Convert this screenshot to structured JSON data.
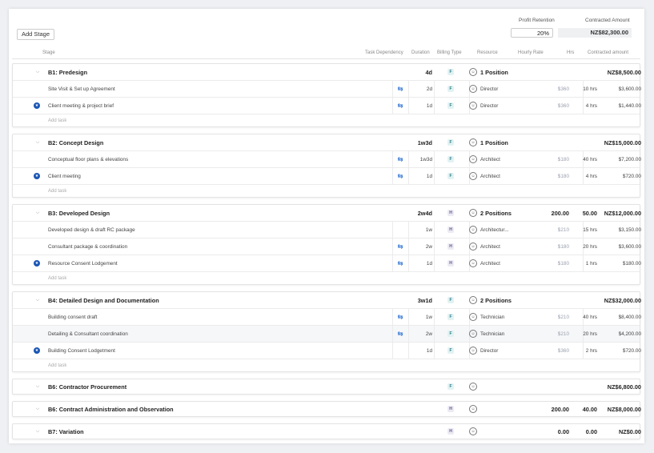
{
  "toolbar": {
    "add_stage_label": "Add Stage",
    "profit_retention_label": "Profit Retention",
    "profit_retention_value": "20%",
    "contracted_amount_label": "Contracted Amount",
    "contracted_amount_value": "NZ$82,300.00"
  },
  "columns": {
    "stage": "Stage",
    "task_dependency": "Task Dependency",
    "duration": "Duration",
    "billing_type": "Billing Type",
    "resource": "Resource",
    "hourly_rate": "Hourly Rate",
    "hrs": "Hrs",
    "contracted_amount": "Contracted amount"
  },
  "add_task_label": "Add task",
  "icons": {
    "collapse": "chevron-down-icon",
    "dependency": "link-arrows-icon",
    "milestone": "star-icon",
    "resource": "person-icon"
  },
  "colors": {
    "accent": "#1b56b4",
    "dependency": "#2a6fd1",
    "badge_f_bg": "#e2f2f3",
    "badge_h_bg": "#ecebf4"
  },
  "stages": [
    {
      "name": "B1: Predesign",
      "duration": "4d",
      "billing": "F",
      "resource": "1 Position",
      "rate": "",
      "hrs": "",
      "amount": "NZ$8,500.00",
      "tasks": [
        {
          "name": "Site Visit & Set up Agreement",
          "dep": true,
          "star": false,
          "duration": "2d",
          "billing": "F",
          "resource": "Director",
          "rate": "$360",
          "hrs": "10 hrs",
          "amount": "$3,600.00"
        },
        {
          "name": "Client meeting & project brief",
          "dep": true,
          "star": true,
          "duration": "1d",
          "billing": "F",
          "resource": "Director",
          "rate": "$360",
          "hrs": "4 hrs",
          "amount": "$1,440.00"
        }
      ]
    },
    {
      "name": "B2: Concept Design",
      "duration": "1w3d",
      "billing": "F",
      "resource": "1 Position",
      "rate": "",
      "hrs": "",
      "amount": "NZ$15,000.00",
      "tasks": [
        {
          "name": "Conceptual floor plans & elevations",
          "dep": true,
          "star": false,
          "duration": "1w3d",
          "billing": "F",
          "resource": "Architect",
          "rate": "$180",
          "hrs": "40 hrs",
          "amount": "$7,200.00"
        },
        {
          "name": "Client meeting",
          "dep": true,
          "star": true,
          "duration": "1d",
          "billing": "F",
          "resource": "Architect",
          "rate": "$180",
          "hrs": "4 hrs",
          "amount": "$720.00"
        }
      ]
    },
    {
      "name": "B3: Developed Design",
      "duration": "2w4d",
      "billing": "H",
      "resource": "2 Positions",
      "rate": "200.00",
      "hrs": "50.00",
      "amount": "NZ$12,000.00",
      "tasks": [
        {
          "name": "Developed design & draft RC package",
          "dep": false,
          "star": false,
          "duration": "1w",
          "billing": "H",
          "resource": "Architectur...",
          "rate": "$210",
          "hrs": "15 hrs",
          "amount": "$3,150.00"
        },
        {
          "name": "Consultant package & coordination",
          "dep": true,
          "star": false,
          "duration": "2w",
          "billing": "H",
          "resource": "Architect",
          "rate": "$180",
          "hrs": "20 hrs",
          "amount": "$3,600.00"
        },
        {
          "name": "Resource Consent Lodgement",
          "dep": true,
          "star": true,
          "duration": "1d",
          "billing": "H",
          "resource": "Architect",
          "rate": "$180",
          "hrs": "1 hrs",
          "amount": "$180.00"
        }
      ]
    },
    {
      "name": "B4: Detailed Design and Documentation",
      "duration": "3w1d",
      "billing": "F",
      "resource": "2 Positions",
      "rate": "",
      "hrs": "",
      "amount": "NZ$32,000.00",
      "tasks": [
        {
          "name": "Building consent draft",
          "dep": true,
          "star": false,
          "duration": "1w",
          "billing": "F",
          "resource": "Technician",
          "rate": "$210",
          "hrs": "40 hrs",
          "amount": "$8,400.00"
        },
        {
          "name": "Detailing & Consultant coordination",
          "dep": true,
          "star": false,
          "highlight": true,
          "duration": "2w",
          "billing": "F",
          "resource": "Technician",
          "rate": "$210",
          "hrs": "20 hrs",
          "amount": "$4,200.00"
        },
        {
          "name": "Building Consent Lodgetment",
          "dep": false,
          "star": true,
          "duration": "1d",
          "billing": "F",
          "resource": "Director",
          "rate": "$360",
          "hrs": "2 hrs",
          "amount": "$720.00"
        }
      ]
    },
    {
      "name": "B6: Contractor Procurement",
      "collapsed": true,
      "duration": "",
      "billing": "F",
      "resource": "",
      "rate": "",
      "hrs": "",
      "amount": "NZ$6,800.00",
      "tasks": []
    },
    {
      "name": "B6: Contract Administration and Observation",
      "collapsed": true,
      "duration": "",
      "billing": "H",
      "resource": "",
      "rate": "200.00",
      "hrs": "40.00",
      "amount": "NZ$8,000.00",
      "tasks": []
    },
    {
      "name": "B7: Variation",
      "collapsed": true,
      "duration": "",
      "billing": "H",
      "resource": "",
      "rate": "0.00",
      "hrs": "0.00",
      "amount": "NZ$0.00",
      "tasks": []
    }
  ]
}
